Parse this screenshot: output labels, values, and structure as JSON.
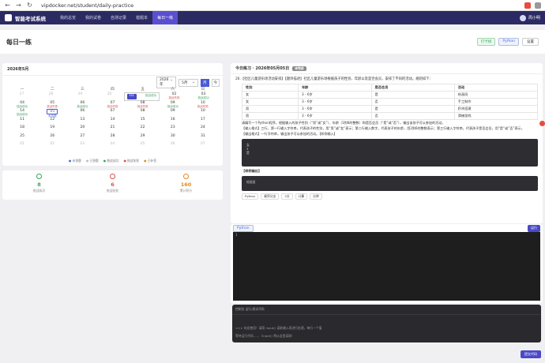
{
  "browser": {
    "url": "vipdocker.net/student/daily-practice"
  },
  "app": {
    "title": "智能考试系统"
  },
  "nav": {
    "items": [
      "我的总览",
      "我的试卷",
      "自测记录",
      "错题本",
      "每日一练"
    ],
    "user": "周小明"
  },
  "page": {
    "title": "每日一练",
    "tag1": "打卡榜",
    "tag2": "Python",
    "btn": "设置"
  },
  "calendar": {
    "title": "2026年5月",
    "year": "2026年",
    "month": "5月",
    "today_btn": "今",
    "month_btn": "月",
    "weekdays": [
      "一",
      "二",
      "三",
      "四",
      "五",
      "六",
      "日"
    ],
    "rows": [
      [
        {
          "d": "27",
          "g": true
        },
        {
          "d": "28",
          "g": true
        },
        {
          "d": "29",
          "g": true
        },
        {
          "d": "30",
          "g": true
        },
        {
          "d": "01",
          "sel": true,
          "st": "挑战成功",
          "c": "green"
        },
        {
          "d": "02",
          "st": "挑战失败",
          "c": "red"
        },
        {
          "d": "03",
          "st": "挑战成功",
          "c": "green"
        }
      ],
      [
        {
          "d": "04",
          "st": "挑战成功",
          "c": "green"
        },
        {
          "d": "05",
          "st": "挑战失败",
          "c": "red"
        },
        {
          "d": "06",
          "st": "挑战成功",
          "c": "green"
        },
        {
          "d": "07",
          "st": "挑战失败",
          "c": "red"
        },
        {
          "d": "08",
          "st": "挑战失败",
          "c": "red"
        },
        {
          "d": "09",
          "st": "挑战成功",
          "c": "green"
        },
        {
          "d": "10",
          "st": "挑战失败",
          "c": "red"
        }
      ],
      [
        {
          "d": "14",
          "st": "挑战成功",
          "c": "green"
        },
        {
          "d": "05",
          "today": true,
          "st": "未答题",
          "c": "blue"
        },
        {
          "d": "06"
        },
        {
          "d": "07"
        },
        {
          "d": "08"
        },
        {
          "d": "09"
        },
        {
          "d": "10"
        }
      ],
      [
        {
          "d": "11"
        },
        {
          "d": "12"
        },
        {
          "d": "13"
        },
        {
          "d": "14"
        },
        {
          "d": "15"
        },
        {
          "d": "16"
        },
        {
          "d": "17"
        }
      ],
      [
        {
          "d": "18"
        },
        {
          "d": "19"
        },
        {
          "d": "20"
        },
        {
          "d": "21"
        },
        {
          "d": "22"
        },
        {
          "d": "23"
        },
        {
          "d": "24"
        }
      ],
      [
        {
          "d": "25"
        },
        {
          "d": "26"
        },
        {
          "d": "27"
        },
        {
          "d": "28"
        },
        {
          "d": "29"
        },
        {
          "d": "30"
        },
        {
          "d": "31"
        }
      ],
      [
        {
          "d": "01",
          "g": true
        },
        {
          "d": "02",
          "g": true
        },
        {
          "d": "03",
          "g": true
        },
        {
          "d": "04",
          "g": true
        },
        {
          "d": "05",
          "g": true
        },
        {
          "d": "06",
          "g": true
        },
        {
          "d": "07",
          "g": true
        }
      ]
    ],
    "legend": [
      "未答题",
      "已答题",
      "挑战成功",
      "挑战失败",
      "已补签"
    ]
  },
  "stats": [
    {
      "v": "8",
      "l": "挑战成功",
      "c": "#3aa55a"
    },
    {
      "v": "6",
      "l": "挑战失败",
      "c": "#d9534f"
    },
    {
      "v": "160",
      "l": "累计积分",
      "c": "#e38a22"
    }
  ],
  "question": {
    "header": "今日练习 · 2026年05月05日",
    "badge": "未完成",
    "title": "26.【社区儿童游乐场活动安排】【题目描述】社区儿童游乐场根据孩子的性别、年龄以及是否会员，安排了不同的活动。规则如下：",
    "headers": [
      "性别",
      "年龄",
      "是否会员",
      "活动"
    ],
    "rows": [
      [
        "女",
        "3 - 6岁",
        "是",
        "绘画班"
      ],
      [
        "女",
        "3 - 6岁",
        "否",
        "手工制作"
      ],
      [
        "男",
        "3 - 6岁",
        "是",
        "积木搭建"
      ],
      [
        "男",
        "3 - 6岁",
        "否",
        "滑梯游戏"
      ]
    ],
    "line1": "请编写一个Python程序，根据输入的孩子性别（“男”或“女”）、年龄（3到6的整数）和是否会员（“是”或“否”），输出该孩子可以参加的活动。",
    "line2": "【输入格式】三行，第一行输入字符串，代表孩子的性别，用“男”或“女”表示；第二行输入数字，代表孩子的年龄，用3到6的整数表示；第三行输入字符串，代表孩子是否会员，用“是”或“否”表示。",
    "line3": "【输出格式】一行字符串，输出孩子可以参加的活动。【样例输入】",
    "sample_in": [
      "女",
      "3",
      "是"
    ],
    "out_label": "【样例输出】",
    "sample_out": "绘画班",
    "tags": [
      "Python",
      "顺序分支",
      "2分",
      "计算",
      "分钟"
    ]
  },
  "editor": {
    "lang": "Python",
    "run": "运行",
    "line": "1"
  },
  "console": {
    "title": "控制台 运行/测试代码",
    "l1": ">>> 欢迎使用！请用 input() 读取输入再进行处理，每行一个值",
    "l2": "等待运行代码……（input() 将从这里读取）",
    "submit": "提交代码"
  }
}
